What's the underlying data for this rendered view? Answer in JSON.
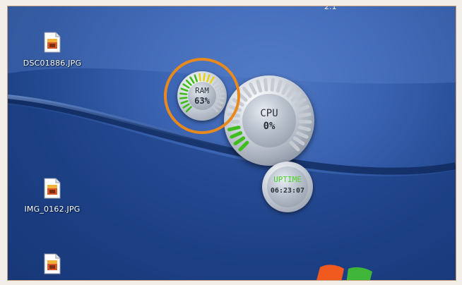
{
  "desktop": {
    "top_label": "2.1",
    "icons": [
      {
        "label": "DSC01886.JPG",
        "icon": "image-file-icon"
      },
      {
        "label": "IMG_0162.JPG",
        "icon": "image-file-icon"
      },
      {
        "label": "",
        "icon": "image-file-icon"
      }
    ]
  },
  "gadgets": {
    "ram": {
      "label": "RAM",
      "value": "63%",
      "percent": 63,
      "highlight_color": "#e8891e"
    },
    "cpu": {
      "label": "CPU",
      "value": "0%",
      "percent": 0
    },
    "uptime": {
      "label": "UPTIME",
      "value": "06:23:07"
    }
  },
  "colors": {
    "gauge_green": "#3fbd1c",
    "gauge_yellow": "#e4d21a",
    "gauge_off": "#c6cbd3",
    "uptime_label": "#4fd12a"
  }
}
